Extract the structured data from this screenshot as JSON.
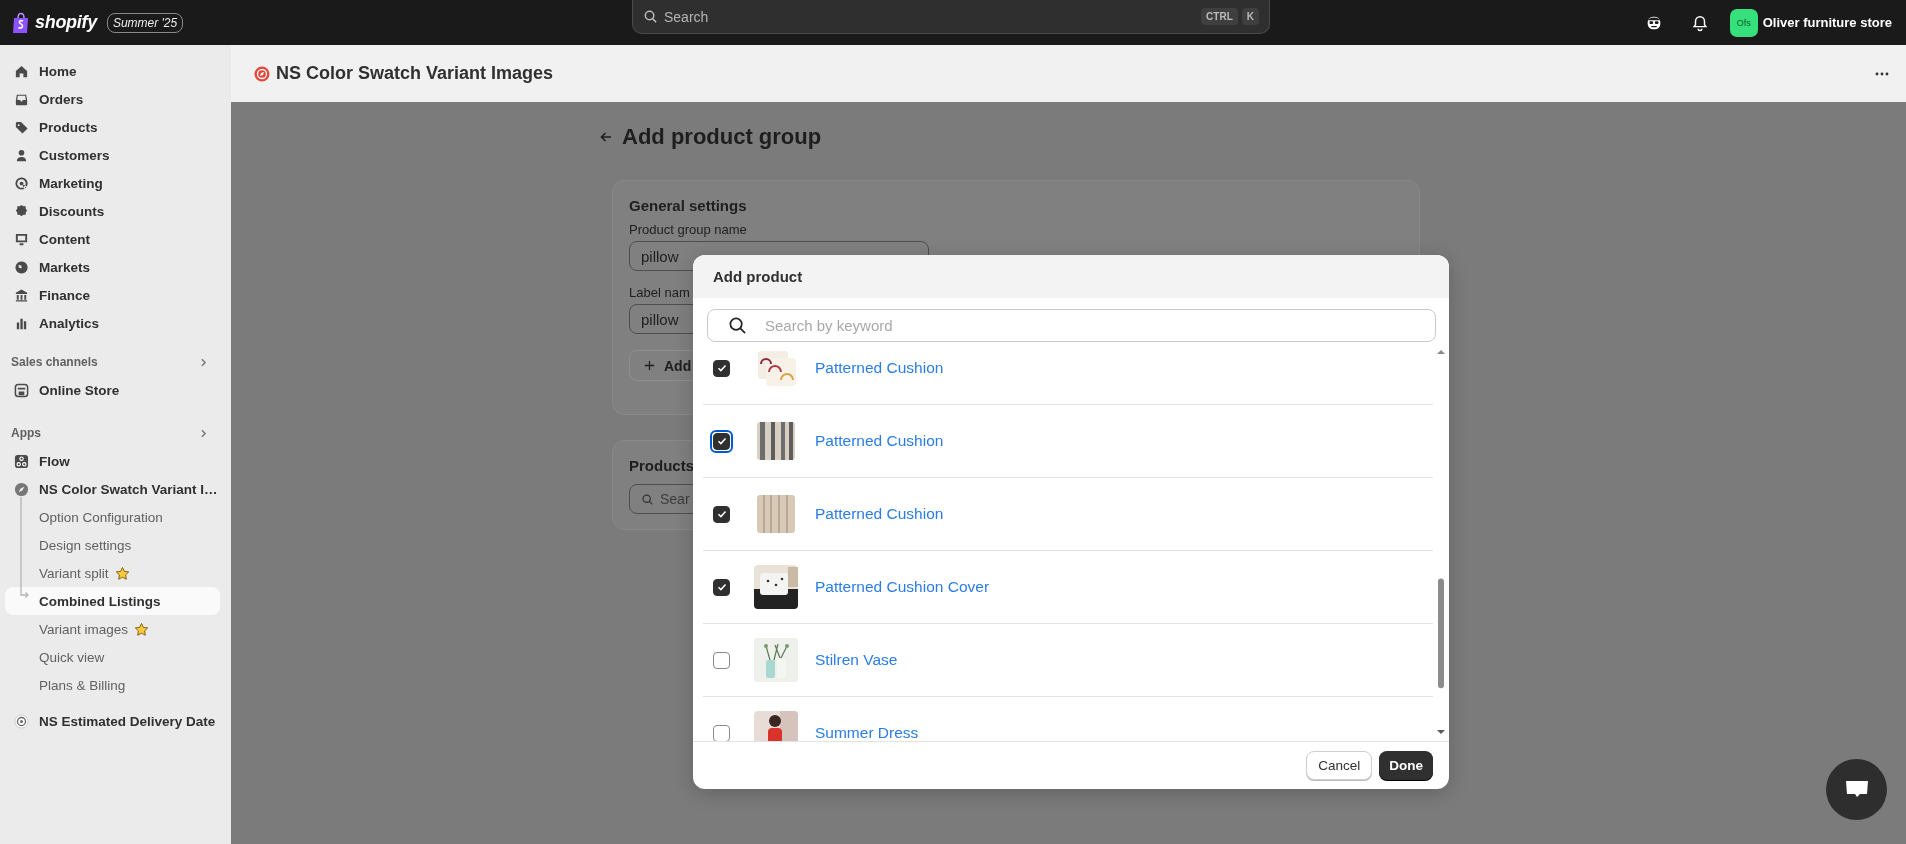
{
  "topbar": {
    "logo_text": "shopify",
    "edition_badge": "Summer '25",
    "search": {
      "placeholder": "Search",
      "shortcut_keys": [
        "CTRL",
        "K"
      ]
    },
    "store": {
      "initials": "Ofs",
      "name": "Oliver furniture store"
    }
  },
  "sidebar": {
    "main_items": [
      "Home",
      "Orders",
      "Products",
      "Customers",
      "Marketing",
      "Discounts",
      "Content",
      "Markets",
      "Finance",
      "Analytics"
    ],
    "sales_channels": {
      "heading": "Sales channels",
      "items": [
        "Online Store"
      ]
    },
    "apps": {
      "heading": "Apps",
      "items": [
        {
          "label": "Flow"
        },
        {
          "label": "NS Color Swatch Variant I…",
          "children": [
            {
              "label": "Option Configuration",
              "selected": false,
              "starred": false
            },
            {
              "label": "Design settings",
              "selected": false,
              "starred": false
            },
            {
              "label": "Variant split",
              "selected": false,
              "starred": true
            },
            {
              "label": "Combined Listings",
              "selected": true,
              "starred": false
            },
            {
              "label": "Variant images",
              "selected": false,
              "starred": true
            },
            {
              "label": "Quick view",
              "selected": false,
              "starred": false
            },
            {
              "label": "Plans & Billing",
              "selected": false,
              "starred": false
            }
          ]
        },
        {
          "label": "NS Estimated Delivery Date"
        }
      ]
    }
  },
  "app_header": {
    "title": "NS Color Swatch Variant Images"
  },
  "page": {
    "title": "Add product group",
    "general_settings": {
      "heading": "General settings",
      "product_group_name": {
        "label": "Product group name",
        "value": "pillow"
      },
      "label_name": {
        "label": "Label nam",
        "value": "pillow"
      },
      "add_button": "Add"
    },
    "products": {
      "heading": "Products",
      "search_placeholder": "Sear"
    }
  },
  "modal": {
    "title": "Add product",
    "search_placeholder": "Search by keyword",
    "products": [
      {
        "name": "Patterned Cushion",
        "checked": true,
        "focused": false
      },
      {
        "name": "Patterned Cushion",
        "checked": true,
        "focused": true
      },
      {
        "name": "Patterned Cushion",
        "checked": true,
        "focused": false
      },
      {
        "name": "Patterned Cushion Cover",
        "checked": true,
        "focused": false
      },
      {
        "name": "Stilren Vase",
        "checked": false,
        "focused": false
      },
      {
        "name": "Summer Dress",
        "checked": false,
        "focused": false
      }
    ],
    "cancel_button": "Cancel",
    "done_button": "Done"
  }
}
